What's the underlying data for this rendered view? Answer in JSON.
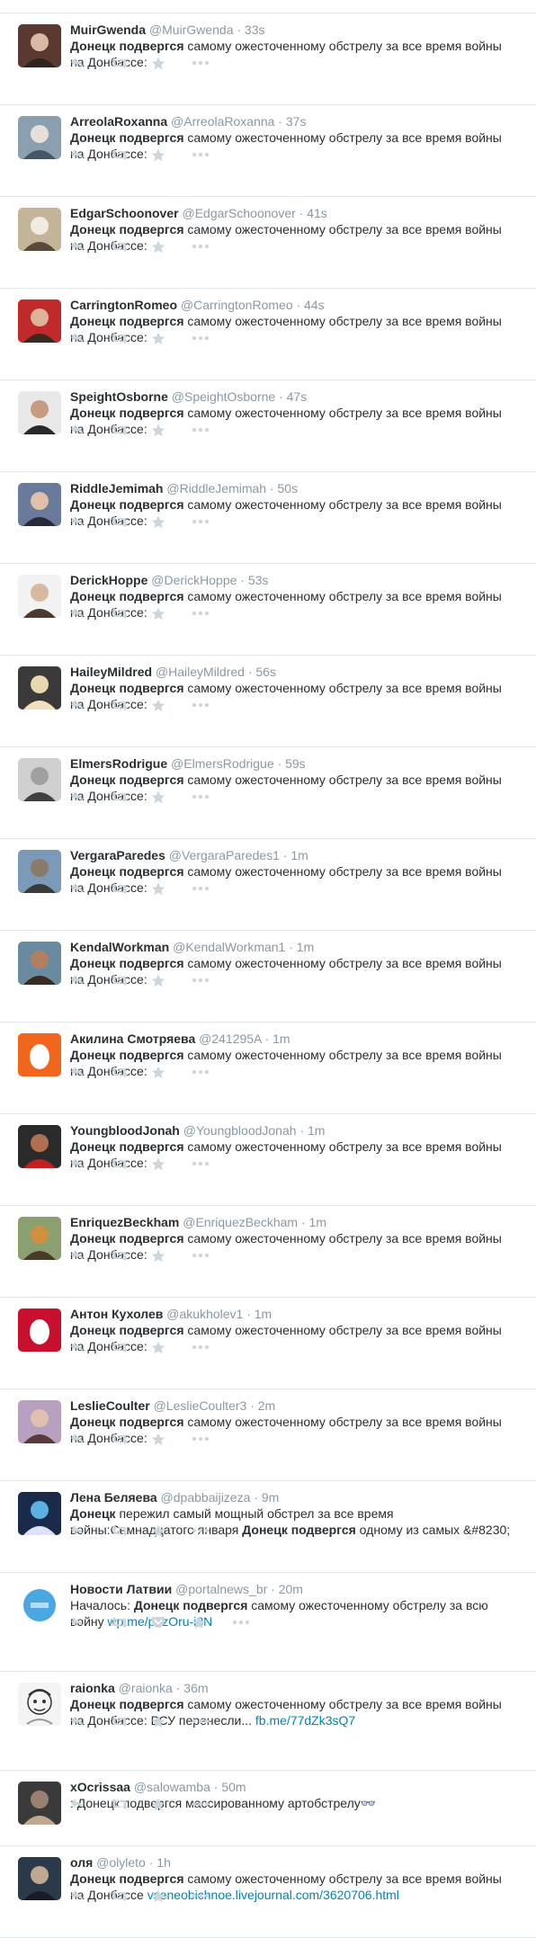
{
  "tweets": [
    {
      "name": "MuirGwenda",
      "handle": "@MuirGwenda",
      "time": "33s",
      "bold": "Донецк подвергся",
      "rest": " самому ожесточенному обстрелу за все время войны на Донбассе:",
      "link": "",
      "avatar": "photo",
      "colors": [
        "#5a3a30",
        "#d9b8a6",
        "#2f2420"
      ]
    },
    {
      "name": "ArreolaRoxanna",
      "handle": "@ArreolaRoxanna",
      "time": "37s",
      "bold": "Донецк подвергся",
      "rest": " самому ожесточенному обстрелу за все время войны на Донбассе:",
      "link": "",
      "avatar": "photo",
      "colors": [
        "#8aa0b0",
        "#e8e0d8",
        "#445566"
      ]
    },
    {
      "name": "EdgarSchoonover",
      "handle": "@EdgarSchoonover",
      "time": "41s",
      "bold": "Донецк подвергся",
      "rest": " самому ожесточенному обстрелу за все время войны на Донбассе:",
      "link": "",
      "avatar": "photo",
      "colors": [
        "#c4b59a",
        "#f0ece2",
        "#5a4a3a"
      ]
    },
    {
      "name": "CarringtonRomeo",
      "handle": "@CarringtonRomeo",
      "time": "44s",
      "bold": "Донецк подвергся",
      "rest": " самому ожесточенному обстрелу за все время войны на Донбассе:",
      "link": "",
      "avatar": "photo",
      "colors": [
        "#c02a2a",
        "#d9b49a",
        "#3a2a20"
      ]
    },
    {
      "name": "SpeightOsborne",
      "handle": "@SpeightOsborne",
      "time": "47s",
      "bold": "Донецк подвергся",
      "rest": " самому ожесточенному обстрелу за все время войны на Донбассе:",
      "link": "",
      "avatar": "photo",
      "colors": [
        "#e8e8e8",
        "#c89a80",
        "#2a2a2a"
      ]
    },
    {
      "name": "RiddleJemimah",
      "handle": "@RiddleJemimah",
      "time": "50s",
      "bold": "Донецк подвергся",
      "rest": " самому ожесточенному обстрелу за все время войны на Донбассе:",
      "link": "",
      "avatar": "photo",
      "colors": [
        "#6a7a9a",
        "#e0c0a8",
        "#2a2a3a"
      ]
    },
    {
      "name": "DerickHoppe",
      "handle": "@DerickHoppe",
      "time": "53s",
      "bold": "Донецк подвергся",
      "rest": " самому ожесточенному обстрелу за все время войны на Донбассе:",
      "link": "",
      "avatar": "photo",
      "colors": [
        "#f2f2f2",
        "#d8b8a0",
        "#4a3a30"
      ]
    },
    {
      "name": "HaileyMildred",
      "handle": "@HaileyMildred",
      "time": "56s",
      "bold": "Донецк подвергся",
      "rest": " самому ожесточенному обстрелу за все время войны на Донбассе:",
      "link": "",
      "avatar": "photo",
      "colors": [
        "#3a3a3a",
        "#e8d8b0",
        "#f0e0c0"
      ]
    },
    {
      "name": "ElmersRodrigue",
      "handle": "@ElmersRodrigue",
      "time": "59s",
      "bold": "Донецк подвергся",
      "rest": " самому ожесточенному обстрелу за все время войны на Донбассе:",
      "link": "",
      "avatar": "photo",
      "colors": [
        "#d0d0d0",
        "#a0a0a0",
        "#404040"
      ]
    },
    {
      "name": "VergaraParedes",
      "handle": "@VergaraParedes1",
      "time": "1m",
      "bold": "Донецк подвергся",
      "rest": " самому ожесточенному обстрелу за все время войны на Донбассе:",
      "link": "",
      "avatar": "photo",
      "colors": [
        "#7a9ab8",
        "#8a7a6a",
        "#3a3a3a"
      ]
    },
    {
      "name": "KendalWorkman",
      "handle": "@KendalWorkman1",
      "time": "1m",
      "bold": "Донецк подвергся",
      "rest": " самому ожесточенному обстрелу за все время войны на Донбассе:",
      "link": "",
      "avatar": "photo",
      "colors": [
        "#6a8aa0",
        "#b08060",
        "#3a2a20"
      ]
    },
    {
      "name": "Акилина Смотряева",
      "handle": "@241295A",
      "time": "1m",
      "bold": "Донецк подвергся",
      "rest": " самому ожесточенному обстрелу за все время войны на Донбассе:",
      "link": "",
      "avatar": "egg",
      "colors": [
        "#f2651d",
        "#ffffff",
        "#ffffff"
      ]
    },
    {
      "name": "YoungbloodJonah",
      "handle": "@YoungbloodJonah",
      "time": "1m",
      "bold": "Донецк подвергся",
      "rest": " самому ожесточенному обстрелу за все время войны на Донбассе:",
      "link": "",
      "avatar": "photo",
      "colors": [
        "#2a2a2a",
        "#b07050",
        "#c02020"
      ]
    },
    {
      "name": "EnriquezBeckham",
      "handle": "@EnriquezBeckham",
      "time": "1m",
      "bold": "Донецк подвергся",
      "rest": " самому ожесточенному обстрелу за все время войны на Донбассе:",
      "link": "",
      "avatar": "photo",
      "colors": [
        "#8aa070",
        "#d09040",
        "#4a3a2a"
      ]
    },
    {
      "name": "Антон Кухолев",
      "handle": "@akukholev1",
      "time": "1m",
      "bold": "Донецк подвергся",
      "rest": " самому ожесточенному обстрелу за все время войны на Донбассе:",
      "link": "",
      "avatar": "egg",
      "colors": [
        "#c8102e",
        "#ffffff",
        "#ffffff"
      ]
    },
    {
      "name": "LeslieCoulter",
      "handle": "@LeslieCoulter3",
      "time": "2m",
      "bold": "Донецк подвергся",
      "rest": " самому ожесточенному обстрелу за все время войны на Донбассе:",
      "link": "",
      "avatar": "photo",
      "colors": [
        "#b8a0c0",
        "#e0c0b0",
        "#5a3a3a"
      ]
    },
    {
      "name": "Лена Беляева",
      "handle": "@dpabbaijizeza",
      "time": "9m",
      "rich": [
        [
          "b",
          "Донецк"
        ],
        [
          "t",
          " пережил самый мощный обстрел за все время войны:Семнадцатого января "
        ],
        [
          "b",
          "Донецк подвергся"
        ],
        [
          "t",
          " одному из самых &#8230;"
        ]
      ],
      "avatar": "photo",
      "colors": [
        "#1a2a4a",
        "#5ab0e0",
        "#e0e0ff"
      ]
    },
    {
      "name": "Новости Латвии",
      "handle": "@portalnews_br",
      "time": "20m",
      "rich": [
        [
          "t",
          "Началось: "
        ],
        [
          "b",
          "Донецк подвергся"
        ],
        [
          "t",
          " самому ожесточенному обстрелу за всю войну "
        ],
        [
          "a",
          "wp.me/p4zOru-i8N"
        ]
      ],
      "avatar": "news",
      "colors": [
        "#ffffff",
        "#4aa8e0",
        "#ffffff"
      ],
      "extra_action": true
    },
    {
      "name": "raionka",
      "handle": "@raionka",
      "time": "36m",
      "rich": [
        [
          "b",
          "Донецк подвергся"
        ],
        [
          "t",
          " самому ожесточенному обстрелу за все время войны на Донбассе: ВСУ перенесли... "
        ],
        [
          "a",
          "fb.me/77dZk3sQ7"
        ]
      ],
      "avatar": "sketch",
      "colors": [
        "#f4f4f4",
        "#333333",
        "#999999"
      ]
    },
    {
      "name": "xOcrissaa",
      "handle": "@salowamba",
      "time": "50m",
      "rich": [
        [
          "t",
          ": Донецк подвергся массированному артобстрелу"
        ],
        [
          "t",
          "👓"
        ]
      ],
      "avatar": "photo",
      "colors": [
        "#3a3a3a",
        "#9a8070",
        "#c0a890"
      ]
    },
    {
      "name": "оля",
      "handle": "@olyleto",
      "time": "1h",
      "rich": [
        [
          "b",
          "Донецк подвергся"
        ],
        [
          "t",
          " самому ожесточенному обстрелу за все время войны на Донбассе "
        ],
        [
          "a",
          "vseneobichnoe.livejournal.com/3620706.html"
        ]
      ],
      "avatar": "photo",
      "colors": [
        "#2a3a4a",
        "#c0a890",
        "#1a1a2a"
      ]
    }
  ],
  "icons": {
    "reply": "reply-icon",
    "retweet": "retweet-icon",
    "pocket": "pocket-icon",
    "favorite": "star-icon",
    "more": "more-icon"
  },
  "action_color": "#ccd6dd",
  "link_color": "#0084b4"
}
